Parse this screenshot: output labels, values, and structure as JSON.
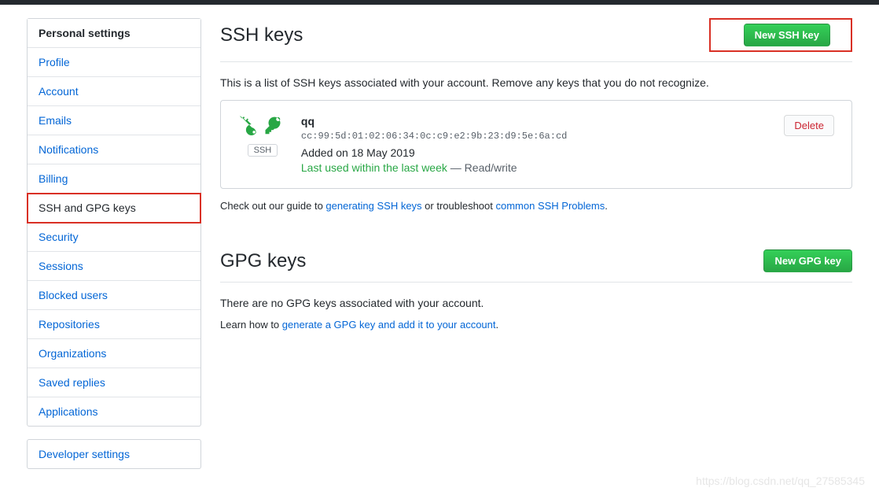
{
  "sidebar": {
    "header": "Personal settings",
    "items": [
      {
        "label": "Profile"
      },
      {
        "label": "Account"
      },
      {
        "label": "Emails"
      },
      {
        "label": "Notifications"
      },
      {
        "label": "Billing"
      },
      {
        "label": "SSH and GPG keys",
        "active": true,
        "highlighted": true
      },
      {
        "label": "Security"
      },
      {
        "label": "Sessions"
      },
      {
        "label": "Blocked users"
      },
      {
        "label": "Repositories"
      },
      {
        "label": "Organizations"
      },
      {
        "label": "Saved replies"
      },
      {
        "label": "Applications"
      }
    ],
    "developer": "Developer settings"
  },
  "ssh": {
    "title": "SSH keys",
    "new_button": "New SSH key",
    "description": "This is a list of SSH keys associated with your account. Remove any keys that you do not recognize.",
    "key": {
      "badge": "SSH",
      "name": "qq",
      "fingerprint": "cc:99:5d:01:02:06:34:0c:c9:e2:9b:23:d9:5e:6a:cd",
      "added": "Added on 18 May 2019",
      "last_used_green": "Last used within the last week",
      "last_used_rest": " — Read/write",
      "delete": "Delete"
    },
    "footer_pre": "Check out our guide to ",
    "footer_link1": "generating SSH keys",
    "footer_mid": " or troubleshoot ",
    "footer_link2": "common SSH Problems",
    "footer_end": "."
  },
  "gpg": {
    "title": "GPG keys",
    "new_button": "New GPG key",
    "description": "There are no GPG keys associated with your account.",
    "footer_pre": "Learn how to ",
    "footer_link": "generate a GPG key and add it to your account",
    "footer_end": "."
  },
  "watermark": "https://blog.csdn.net/qq_27585345"
}
